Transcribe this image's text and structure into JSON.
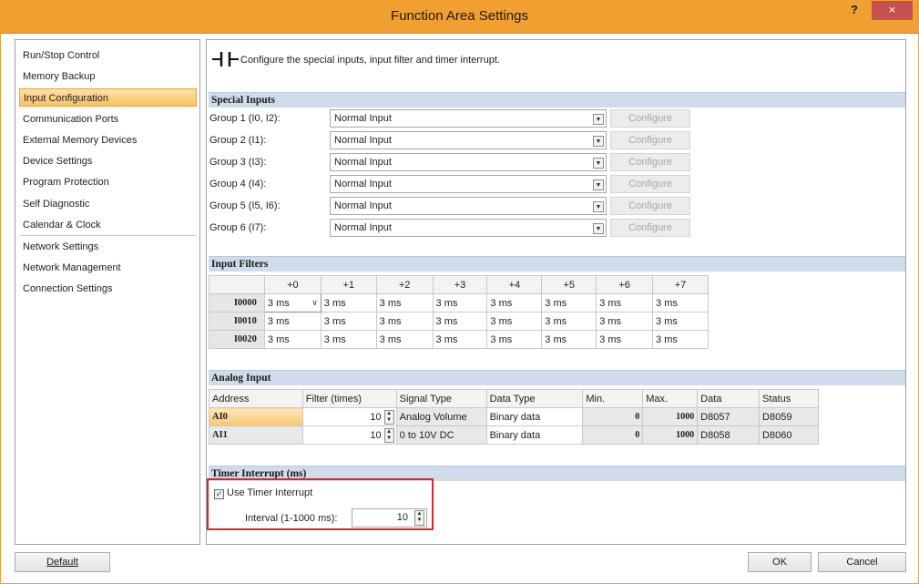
{
  "window": {
    "title": "Function Area Settings",
    "help": "?",
    "close": "×"
  },
  "nav": {
    "items": [
      {
        "label": "Run/Stop Control"
      },
      {
        "label": "Memory Backup"
      },
      {
        "label": "Input Configuration",
        "selected": true
      },
      {
        "label": "Communication Ports"
      },
      {
        "label": "External Memory Devices"
      },
      {
        "label": "Device Settings"
      },
      {
        "label": "Program Protection"
      },
      {
        "label": "Self Diagnostic"
      },
      {
        "label": "Calendar & Clock"
      },
      {
        "label": "Network Settings"
      },
      {
        "label": "Network Management"
      },
      {
        "label": "Connection Settings"
      }
    ]
  },
  "main": {
    "hint": "Configure the special inputs, input filter and timer interrupt.",
    "special_inputs": {
      "title": "Special Inputs",
      "rows": [
        {
          "label": "Group 1 (I0, I2):",
          "value": "Normal Input",
          "button": "Configure"
        },
        {
          "label": "Group 2 (I1):",
          "value": "Normal Input",
          "button": "Configure"
        },
        {
          "label": "Group 3 (I3):",
          "value": "Normal Input",
          "button": "Configure"
        },
        {
          "label": "Group 4 (I4):",
          "value": "Normal Input",
          "button": "Configure"
        },
        {
          "label": "Group 5 (I5, I6):",
          "value": "Normal Input",
          "button": "Configure"
        },
        {
          "label": "Group 6 (I7):",
          "value": "Normal Input",
          "button": "Configure"
        }
      ]
    },
    "input_filters": {
      "title": "Input Filters",
      "columns": [
        "+0",
        "+1",
        "+2",
        "+3",
        "+4",
        "+5",
        "+6",
        "+7"
      ],
      "rows": [
        {
          "label": "I0000",
          "values": [
            "3 ms",
            "3 ms",
            "3 ms",
            "3 ms",
            "3 ms",
            "3 ms",
            "3 ms",
            "3 ms"
          ]
        },
        {
          "label": "I0010",
          "values": [
            "3 ms",
            "3 ms",
            "3 ms",
            "3 ms",
            "3 ms",
            "3 ms",
            "3 ms",
            "3 ms"
          ]
        },
        {
          "label": "I0020",
          "values": [
            "3 ms",
            "3 ms",
            "3 ms",
            "3 ms",
            "3 ms",
            "3 ms",
            "3 ms",
            "3 ms"
          ]
        }
      ]
    },
    "analog_input": {
      "title": "Analog Input",
      "columns": [
        "Address",
        "Filter (times)",
        "Signal Type",
        "Data Type",
        "Min.",
        "Max.",
        "Data",
        "Status"
      ],
      "rows": [
        {
          "address": "AI0",
          "filter": "10",
          "signal": "Analog Volume",
          "data_type": "Binary data",
          "min": "0",
          "max": "1000",
          "data": "D8057",
          "status": "D8059"
        },
        {
          "address": "AI1",
          "filter": "10",
          "signal": "0 to 10V DC",
          "data_type": "Binary data",
          "min": "0",
          "max": "1000",
          "data": "D8058",
          "status": "D8060"
        }
      ]
    },
    "timer_interrupt": {
      "title": "Timer Interrupt (ms)",
      "checkbox_label": "Use Timer Interrupt",
      "checked": true,
      "interval_label": "Interval (1-1000 ms):",
      "interval_value": "10",
      "highlight_color": "#d92a2a"
    }
  },
  "footer": {
    "default_label": "Default",
    "ok_label": "OK",
    "cancel_label": "Cancel"
  },
  "colors": {
    "title_bar": "#f0a030",
    "selection": "#f7c15f",
    "section_header": "#cfdcec",
    "close_button": "#c75050"
  }
}
